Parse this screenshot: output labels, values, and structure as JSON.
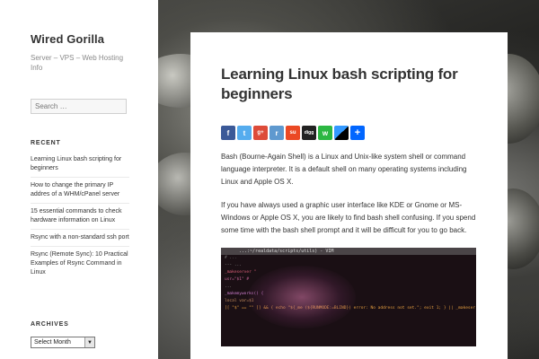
{
  "site": {
    "title": "Wired Gorilla",
    "description": "Server – VPS – Web Hosting Info"
  },
  "search": {
    "placeholder": "Search …"
  },
  "recent": {
    "heading": "RECENT",
    "items": [
      "Learning Linux bash scripting for beginners",
      "How to change the primary IP addres of a WHM/cPanel server",
      "15 essential commands to check hardware information on Linux",
      "Rsync with a non-standard ssh port",
      "Rsync (Remote Sync): 10 Practical Examples of Rsync Command in Linux"
    ]
  },
  "archives": {
    "heading": "ARCHIVES",
    "select_value": "Select Month"
  },
  "article": {
    "title": "Learning Linux bash scripting for beginners",
    "paragraphs": [
      "Bash (Bourne-Again Shell) is a Linux and Unix-like system shell or command language interpreter. It is a default shell on many operating systems including Linux and Apple OS X.",
      "If you have always used a graphic user interface like KDE or Gnome or MS-Windows or Apple OS X, you are likely to find bash shell confusing. If you spend some time with the bash shell prompt and it will be difficult for you to go back."
    ]
  },
  "share": [
    {
      "icon": "facebook-icon",
      "glyph": "f",
      "color": "#3b5998"
    },
    {
      "icon": "twitter-icon",
      "glyph": "t",
      "color": "#55acee"
    },
    {
      "icon": "google-plus-icon",
      "glyph": "g+",
      "color": "#dd4b39"
    },
    {
      "icon": "reddit-icon",
      "glyph": "r",
      "color": "#5f99cf"
    },
    {
      "icon": "stumbleupon-icon",
      "glyph": "su",
      "color": "#eb4924"
    },
    {
      "icon": "digg-icon",
      "glyph": "digg",
      "color": "#222222"
    },
    {
      "icon": "whatsapp-icon",
      "glyph": "w",
      "color": "#2cb742"
    },
    {
      "icon": "delicious-icon",
      "glyph": "",
      "color": "#3399ff"
    },
    {
      "icon": "addtoany-share-icon",
      "glyph": "+",
      "color": "#0166ff"
    }
  ],
  "terminal": {
    "title": "...:~/realdata/scripts/utils) - VIM",
    "lines": [
      {
        "text": "# ...",
        "color": "#7a7a7a"
      },
      {
        "text": "--- ...",
        "color": "#9a9a9a"
      },
      {
        "text": "_makeserver \"",
        "color": "#e0607a"
      },
      {
        "text": "usr=\"$1\" #",
        "color": "#d06aa0"
      },
      {
        "text": "...",
        "color": "#9a9a9a"
      },
      {
        "text": "_makemyworks() {",
        "color": "#cf7fd0"
      },
      {
        "text": "  local var=$1",
        "color": "#c99060"
      },
      {
        "text": "  [[ \"$\" == \"\" ]] && { echo \"${_me  (${RUNMODE:=BLIND}) error: No address not set.\"; exit 1; } || _makeser",
        "color": "#e8a040"
      }
    ]
  }
}
